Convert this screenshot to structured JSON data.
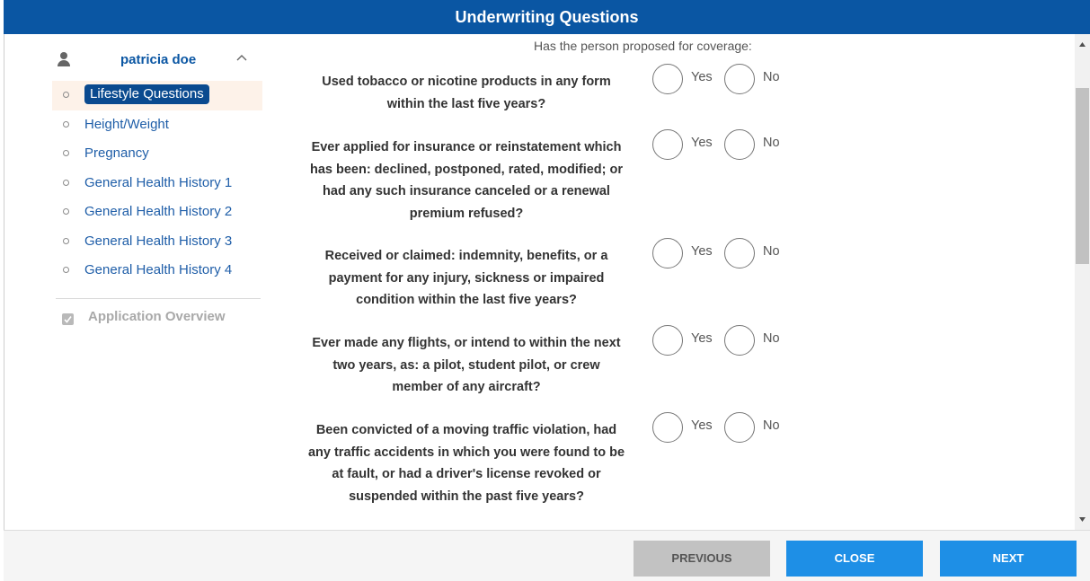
{
  "header": {
    "title": "Underwriting Questions"
  },
  "sidebar": {
    "user_name": "patricia doe",
    "user_icon": "person-icon",
    "collapse_icon": "chevron-up-icon",
    "items": [
      {
        "label": "Lifestyle Questions",
        "active": true
      },
      {
        "label": "Height/Weight"
      },
      {
        "label": "Pregnancy"
      },
      {
        "label": "General Health History 1"
      },
      {
        "label": "General Health History 2"
      },
      {
        "label": "General Health History 3"
      },
      {
        "label": "General Health History 4"
      }
    ],
    "overview_label": "Application Overview",
    "overview_icon": "checkbox-checked-icon"
  },
  "main": {
    "intro": "Has the person proposed for coverage:",
    "yes_label": "Yes",
    "no_label": "No",
    "questions": [
      {
        "lines": [
          "Used tobacco or nicotine products in any form",
          "within the last five years?"
        ]
      },
      {
        "lines": [
          "Ever applied for insurance or reinstatement which",
          "has been: declined, postponed, rated, modified; or",
          "had any such insurance canceled or a renewal",
          "premium refused?"
        ]
      },
      {
        "lines": [
          "Received or claimed: indemnity, benefits, or a",
          "payment for any injury, sickness or impaired",
          "condition within the last five years?"
        ]
      },
      {
        "lines": [
          "Ever made any flights, or intend to within the next",
          "two years, as: a pilot, student pilot, or crew",
          "member of any aircraft?"
        ]
      },
      {
        "lines": [
          "Been convicted of a moving traffic violation, had",
          "any traffic accidents in which you were found to be",
          "at fault, or had a driver's license revoked or",
          "suspended within the past five years?"
        ]
      }
    ]
  },
  "footer": {
    "previous_label": "PREVIOUS",
    "close_label": "CLOSE",
    "next_label": "NEXT"
  },
  "colors": {
    "header_bg": "#0a56a3",
    "primary_button": "#1e8fe6",
    "disabled_button": "#c2c2c2",
    "link": "#1f5ea8",
    "active_highlight": "#fdf2e9"
  }
}
